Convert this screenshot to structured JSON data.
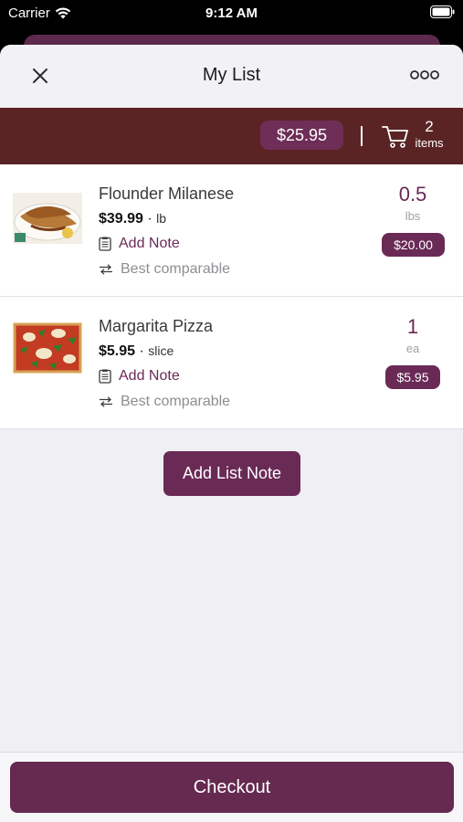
{
  "status_bar": {
    "carrier": "Carrier",
    "time": "9:12 AM"
  },
  "header": {
    "title": "My List",
    "close_icon": "close-icon",
    "more_icon": "more-icon"
  },
  "summary": {
    "total": "$25.95",
    "item_count": "2",
    "item_label": "items",
    "cart_icon": "cart-icon"
  },
  "items": [
    {
      "name": "Flounder Milanese",
      "price": "$39.99",
      "unit": "lb",
      "note_label": "Add Note",
      "compare_label": "Best comparable",
      "quantity": "0.5",
      "quantity_unit": "lbs",
      "line_total": "$20.00"
    },
    {
      "name": "Margarita Pizza",
      "price": "$5.95",
      "unit": "slice",
      "note_label": "Add Note",
      "compare_label": "Best comparable",
      "quantity": "1",
      "quantity_unit": "ea",
      "line_total": "$5.95"
    }
  ],
  "add_list_note_label": "Add List Note",
  "checkout_label": "Checkout",
  "colors": {
    "brand": "#6a2a56",
    "summary_bar": "#5a2424",
    "muted_text": "#8e8e93"
  }
}
